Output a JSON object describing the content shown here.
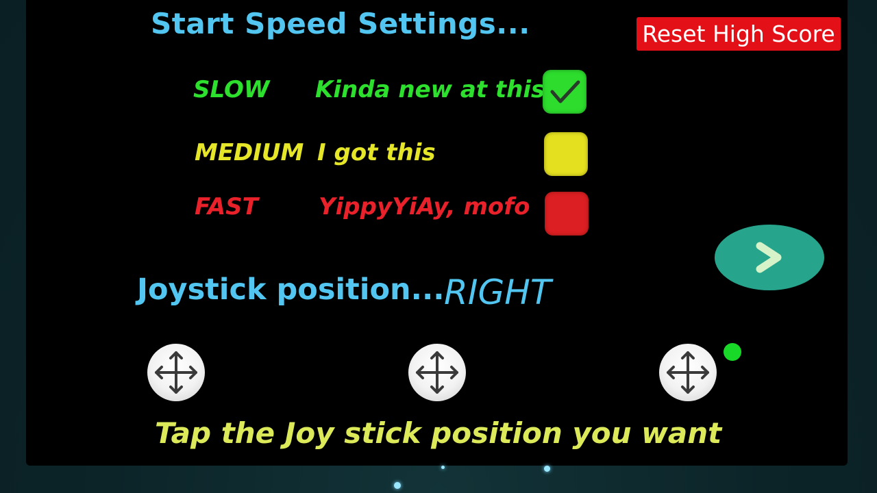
{
  "title": "Start Speed Settings...",
  "reset_button": "Reset High Score",
  "speeds": [
    {
      "label": "SLOW",
      "description": "Kinda new at this",
      "color": "#2ee02e",
      "checked": true
    },
    {
      "label": "MEDIUM",
      "description": "I got this",
      "color": "#e6e628",
      "checked": false
    },
    {
      "label": "FAST",
      "description": "YippyYiAy, mofo",
      "color": "#e8212a",
      "checked": false
    }
  ],
  "joystick": {
    "label": "Joystick position...",
    "value": "RIGHT",
    "selected_index": 2,
    "options_icon": "move-arrows-icon"
  },
  "hint": "Tap the Joy stick position you want",
  "next_icon": "chevron-right-icon",
  "colors": {
    "accent": "#52c6f0",
    "next_button": "#26a48c",
    "reset_button": "#e31018",
    "hint": "#dcea5a",
    "indicator": "#18d828"
  }
}
